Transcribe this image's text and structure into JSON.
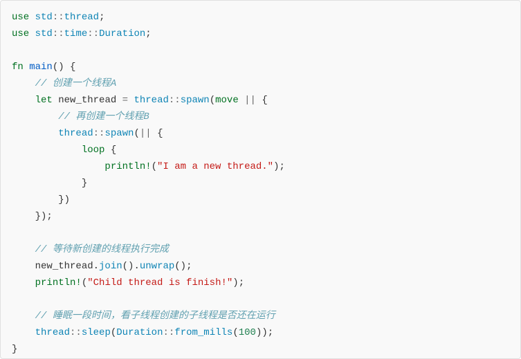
{
  "code": {
    "l1": {
      "kw1": "use",
      "sp": " ",
      "ns1": "std",
      "dc1": "::",
      "ns2": "thread",
      "sc": ";"
    },
    "l2": {
      "kw1": "use",
      "sp": " ",
      "ns1": "std",
      "dc1": "::",
      "ns2": "time",
      "dc2": "::",
      "ns3": "Duration",
      "sc": ";"
    },
    "l3": {
      "blank": ""
    },
    "l4": {
      "kw1": "fn",
      "sp": " ",
      "name": "main",
      "paren": "()",
      "sp2": " ",
      "brace": "{"
    },
    "l5": {
      "indent": "    ",
      "cm": "// 创建一个线程A"
    },
    "l6": {
      "indent": "    ",
      "kw1": "let",
      "sp": " ",
      "var": "new_thread",
      "sp2": " ",
      "eq": "=",
      "sp3": " ",
      "ns1": "thread",
      "dc": "::",
      "fn1": "spawn",
      "po": "(",
      "kw2": "move",
      "sp4": " ",
      "bars": "||",
      "sp5": " ",
      "brace": "{"
    },
    "l7": {
      "indent": "        ",
      "cm": "// 再创建一个线程B"
    },
    "l8": {
      "indent": "        ",
      "ns1": "thread",
      "dc": "::",
      "fn1": "spawn",
      "po": "(",
      "bars": "||",
      "sp": " ",
      "brace": "{"
    },
    "l9": {
      "indent": "            ",
      "kw1": "loop",
      "sp": " ",
      "brace": "{"
    },
    "l10": {
      "indent": "                ",
      "mac": "println!",
      "po": "(",
      "str": "\"I am a new thread.\"",
      "pc": ")",
      "sc": ";"
    },
    "l11": {
      "indent": "            ",
      "brace": "}"
    },
    "l12": {
      "indent": "        ",
      "brace": "}",
      "pc": ")"
    },
    "l13": {
      "indent": "    ",
      "brace": "}",
      "pc": ")",
      "sc": ";"
    },
    "l14": {
      "blank": ""
    },
    "l15": {
      "indent": "    ",
      "cm": "// 等待新创建的线程执行完成"
    },
    "l16": {
      "indent": "    ",
      "var": "new_thread",
      "dot1": ".",
      "fn1": "join",
      "p1": "()",
      "dot2": ".",
      "fn2": "unwrap",
      "p2": "()",
      "sc": ";"
    },
    "l17": {
      "indent": "    ",
      "mac": "println!",
      "po": "(",
      "str": "\"Child thread is finish!\"",
      "pc": ")",
      "sc": ";"
    },
    "l18": {
      "blank": ""
    },
    "l19": {
      "indent": "    ",
      "cm": "// 睡眠一段时间，看子线程创建的子线程是否还在运行"
    },
    "l20": {
      "indent": "    ",
      "ns1": "thread",
      "dc1": "::",
      "fn1": "sleep",
      "po": "(",
      "ns2": "Duration",
      "dc2": "::",
      "fn2": "from_mills",
      "po2": "(",
      "num": "100",
      "pc2": ")",
      "pc": ")",
      "sc": ";"
    },
    "l21": {
      "brace": "}"
    }
  }
}
